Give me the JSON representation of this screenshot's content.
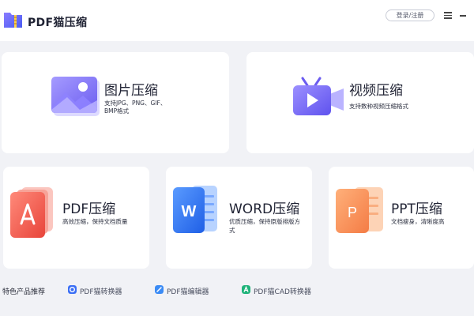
{
  "app": {
    "title": "PDF猫压缩"
  },
  "header": {
    "login_label": "登录/注册",
    "menu_icon": "hamburger-menu-icon",
    "minimize_icon": "minimize-icon"
  },
  "cards": {
    "image": {
      "title": "图片压缩",
      "desc_line1": "支持JPG、PNG、GIF、",
      "desc_line2": "BMP格式",
      "icon": "image-icon"
    },
    "video": {
      "title": "视频压缩",
      "desc": "支持数种视频压缩格式",
      "icon": "video-camera-icon"
    },
    "pdf": {
      "title": "PDF压缩",
      "desc": "高效压缩，保持文档质量",
      "icon": "pdf-file-icon"
    },
    "word": {
      "title": "WORD压缩",
      "desc_line1": "优质压缩，保持原版排版方",
      "desc_line2": "式",
      "icon": "word-file-icon"
    },
    "ppt": {
      "title": "PPT压缩",
      "desc": "文档瘦身，清晰度高",
      "icon": "ppt-file-icon"
    }
  },
  "footer": {
    "label": "特色产品推荐",
    "tools": [
      {
        "label": "PDF猫转换器",
        "icon": "pdf-converter-icon",
        "color": "#3b6ff5"
      },
      {
        "label": "PDF猫编辑器",
        "icon": "pdf-editor-icon",
        "color": "#3b8bf5"
      },
      {
        "label": "PDF猫CAD转换器",
        "icon": "cad-converter-icon",
        "color": "#1fb37a"
      }
    ]
  },
  "colors": {
    "accent": "#6b5cf0",
    "pdf_red": "#f05a4f",
    "word_blue": "#2f6ff0",
    "ppt_orange": "#f7925b",
    "background": "#f1f2f6"
  }
}
